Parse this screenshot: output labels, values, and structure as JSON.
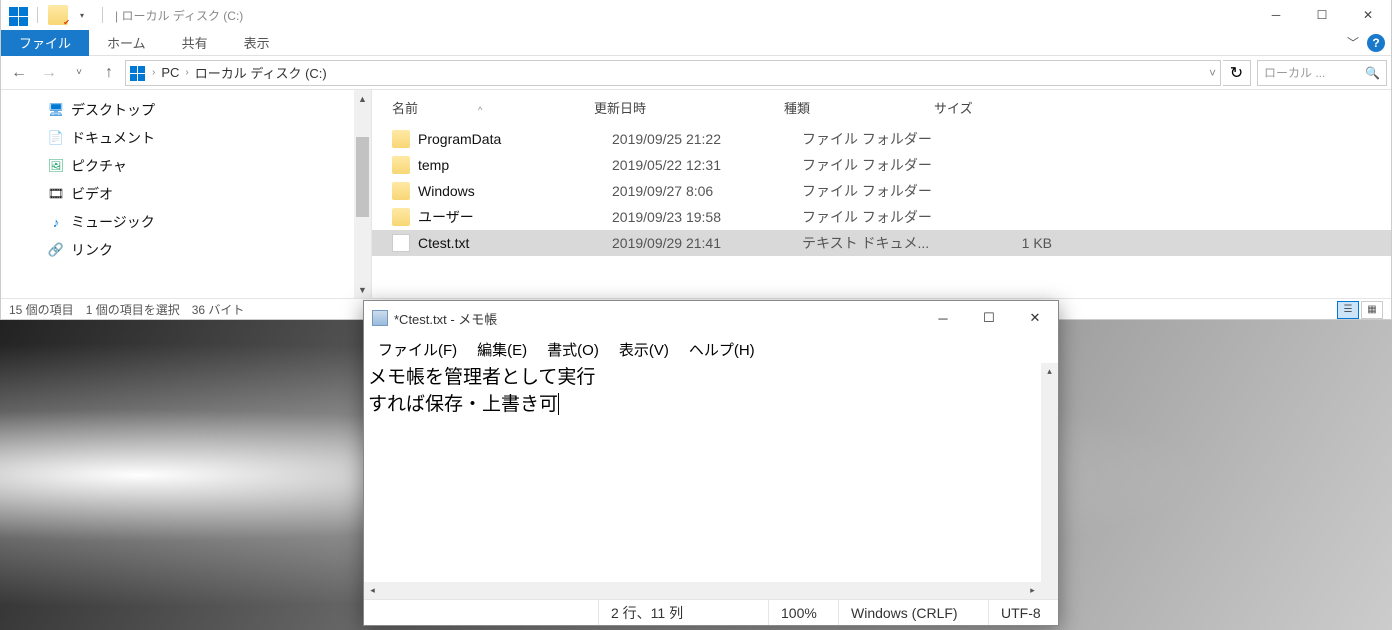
{
  "explorer": {
    "title": " | ローカル ディスク (C:)",
    "ribbon": {
      "file": "ファイル",
      "tabs": [
        "ホーム",
        "共有",
        "表示"
      ]
    },
    "breadcrumb": [
      "PC",
      "ローカル ディスク (C:)"
    ],
    "search_placeholder": "ローカル ...",
    "sidebar": [
      {
        "icon": "desktop",
        "label": "デスクトップ"
      },
      {
        "icon": "document",
        "label": "ドキュメント"
      },
      {
        "icon": "picture",
        "label": "ピクチャ"
      },
      {
        "icon": "video",
        "label": "ビデオ"
      },
      {
        "icon": "music",
        "label": "ミュージック"
      },
      {
        "icon": "link",
        "label": "リンク"
      }
    ],
    "columns": {
      "name": "名前",
      "date": "更新日時",
      "type": "種類",
      "size": "サイズ"
    },
    "rows": [
      {
        "name": "ProgramData",
        "date": "2019/09/25 21:22",
        "type": "ファイル フォルダー",
        "size": "",
        "kind": "folder"
      },
      {
        "name": "temp",
        "date": "2019/05/22 12:31",
        "type": "ファイル フォルダー",
        "size": "",
        "kind": "folder"
      },
      {
        "name": "Windows",
        "date": "2019/09/27 8:06",
        "type": "ファイル フォルダー",
        "size": "",
        "kind": "folder"
      },
      {
        "name": "ユーザー",
        "date": "2019/09/23 19:58",
        "type": "ファイル フォルダー",
        "size": "",
        "kind": "folder"
      },
      {
        "name": "Ctest.txt",
        "date": "2019/09/29 21:41",
        "type": "テキスト ドキュメ...",
        "size": "1 KB",
        "kind": "file",
        "selected": true
      }
    ],
    "status": {
      "count": "15 個の項目",
      "selected": "1 個の項目を選択",
      "size": "36 バイト"
    }
  },
  "notepad": {
    "title": "*Ctest.txt - メモ帳",
    "menu": [
      "ファイル(F)",
      "編集(E)",
      "書式(O)",
      "表示(V)",
      "ヘルプ(H)"
    ],
    "content_line1": "メモ帳を管理者として実行",
    "content_line2": "すれば保存・上書き可",
    "status": {
      "pos": "2 行、11 列",
      "zoom": "100%",
      "eol": "Windows (CRLF)",
      "enc": "UTF-8"
    }
  }
}
